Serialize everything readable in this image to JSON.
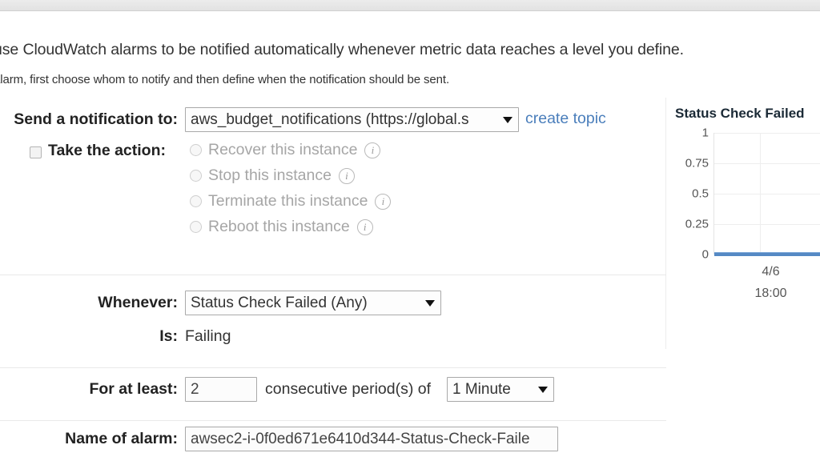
{
  "intro": {
    "line1": "use CloudWatch alarms to be notified automatically whenever metric data reaches a level you define.",
    "line2": "alarm, first choose whom to notify and then define when the notification should be sent."
  },
  "form": {
    "notification": {
      "label": "Send a notification to:",
      "selected": "aws_budget_notifications (https://global.s",
      "create_topic_link": "create topic"
    },
    "action": {
      "label": "Take the action:",
      "checked": false,
      "options": [
        {
          "label": "Recover this instance",
          "info": "i",
          "selected": false,
          "disabled": true
        },
        {
          "label": "Stop this instance",
          "info": "i",
          "selected": false,
          "disabled": true
        },
        {
          "label": "Terminate this instance",
          "info": "i",
          "selected": false,
          "disabled": true
        },
        {
          "label": "Reboot this instance",
          "info": "i",
          "selected": false,
          "disabled": true
        }
      ]
    },
    "whenever": {
      "label": "Whenever:",
      "selected": "Status Check Failed (Any)"
    },
    "is": {
      "label": "Is:",
      "value": "Failing"
    },
    "for_at_least": {
      "label": "For at least:",
      "count": "2",
      "middle_text": "consecutive period(s) of",
      "period": "1 Minute"
    },
    "alarm_name": {
      "label": "Name of alarm:",
      "value": "awsec2-i-0f0ed671e6410d344-Status-Check-Faile"
    }
  },
  "chart_data": {
    "type": "line",
    "title": "Status Check Failed",
    "xlabel": "",
    "ylabel": "",
    "ylim": [
      0,
      1
    ],
    "yticks": [
      "1",
      "0.75",
      "0.5",
      "0.25",
      "0"
    ],
    "ytick_values": [
      1,
      0.75,
      0.5,
      0.25,
      0
    ],
    "x_tick_labels": [
      "4/6",
      "18:00"
    ],
    "categories": [
      "4/6 18:00"
    ],
    "series": [
      {
        "name": "Status Check Failed",
        "values": [
          0,
          0,
          0,
          0,
          0
        ],
        "color": "#5589c4"
      }
    ],
    "grid": true,
    "legend": "none"
  },
  "colors": {
    "link": "#4a7ebb",
    "series": "#5589c4",
    "text": "#333333",
    "disabled_text": "#a6a6a6"
  }
}
